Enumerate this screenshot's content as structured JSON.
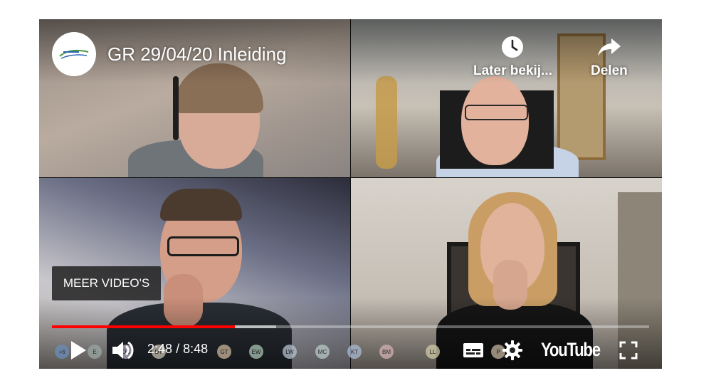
{
  "video": {
    "title": "GR 29/04/20 Inleiding"
  },
  "top_actions": {
    "watch_later_label": "Later bekij...",
    "share_label": "Delen"
  },
  "overlay": {
    "more_videos_label": "MEER VIDEO'S"
  },
  "player": {
    "current_time": "2:48",
    "separator": "/",
    "duration": "8:48",
    "progress_played": 0.306,
    "progress_buffered": 0.376,
    "brand_label": "YouTube"
  },
  "participant_initials": [
    {
      "text": "+6",
      "color": "#6a8dbb"
    },
    {
      "text": "E",
      "color": "#9aa7a3"
    },
    {
      "text": "DS",
      "color": "#b9b2c6"
    },
    {
      "text": "DT",
      "color": "#c8c0b0"
    },
    {
      "text": "GT",
      "color": "#c9b59a"
    },
    {
      "text": "EW",
      "color": "#a9c4b3"
    },
    {
      "text": "LW",
      "color": "#b6c3cf"
    },
    {
      "text": "MC",
      "color": "#b9c9c6"
    },
    {
      "text": "KT",
      "color": "#a9b9d3"
    },
    {
      "text": "BM",
      "color": "#d3b1b1"
    },
    {
      "text": "LL",
      "color": "#d0c9a8"
    },
    {
      "text": "P",
      "color": "#c3b39e"
    }
  ],
  "colors": {
    "progress_played": "#ff0000",
    "logo_accent": "#4a9a3a",
    "logo_blue": "#2b67b3"
  }
}
